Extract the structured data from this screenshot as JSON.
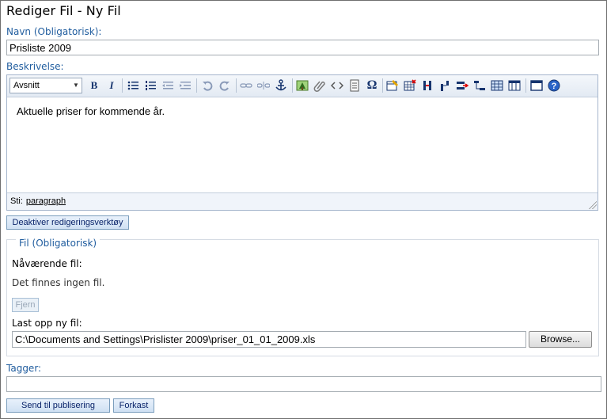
{
  "title": "Rediger Fil - Ny Fil",
  "name_field": {
    "label": "Navn (Obligatorisk):",
    "value": "Prisliste 2009"
  },
  "description": {
    "label": "Beskrivelse:",
    "format_select": "Avsnitt",
    "content": "Aktuelle priser for kommende år.",
    "path_label": "Sti:",
    "path_value": "paragraph"
  },
  "toolbar_icons": {
    "bold": "B",
    "italic": "I"
  },
  "toggle_editor_button": "Deaktiver redigeringsverktøy",
  "file_section": {
    "legend": "Fil (Obligatorisk)",
    "current_label": "Nåværende fil:",
    "current_value": "Det finnes ingen fil.",
    "remove_button": "Fjern",
    "upload_label": "Last opp ny fil:",
    "upload_path": "C:\\Documents and Settings\\Prislister 2009\\priser_01_01_2009.xls",
    "browse_button": "Browse..."
  },
  "tags": {
    "label": "Tagger:",
    "value": ""
  },
  "actions": {
    "submit_button": "Send til publisering",
    "discard_button": "Forkast"
  },
  "colors": {
    "label_blue": "#1f5c9e",
    "button_text": "#0a246a",
    "toolbar_icon": "#16346e"
  }
}
